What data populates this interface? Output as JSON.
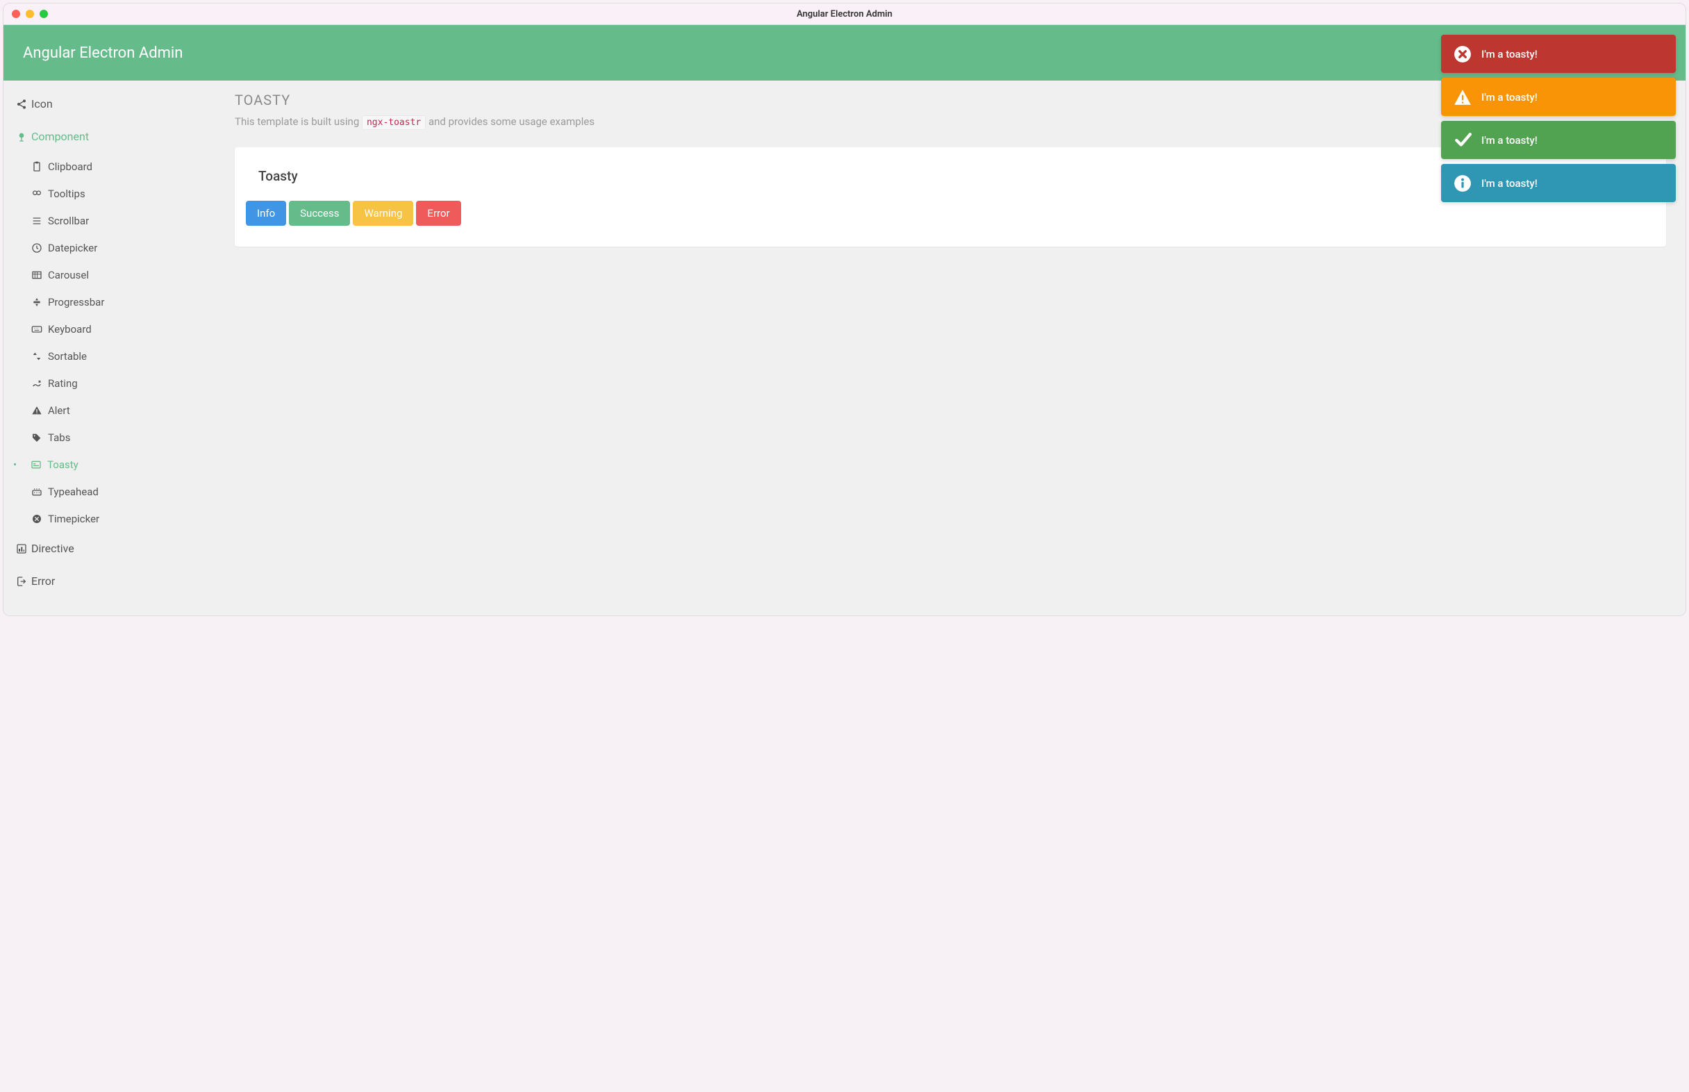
{
  "window_title": "Angular Electron Admin",
  "header_title": "Angular Electron Admin",
  "sidebar": {
    "icon_label": "Icon",
    "component_label": "Component",
    "directive_label": "Directive",
    "error_label": "Error",
    "components": [
      {
        "label": "Clipboard",
        "icon": "clipboard"
      },
      {
        "label": "Tooltips",
        "icon": "tooltips"
      },
      {
        "label": "Scrollbar",
        "icon": "scrollbar"
      },
      {
        "label": "Datepicker",
        "icon": "datepicker"
      },
      {
        "label": "Carousel",
        "icon": "carousel"
      },
      {
        "label": "Progressbar",
        "icon": "progressbar"
      },
      {
        "label": "Keyboard",
        "icon": "keyboard"
      },
      {
        "label": "Sortable",
        "icon": "sortable"
      },
      {
        "label": "Rating",
        "icon": "rating"
      },
      {
        "label": "Alert",
        "icon": "alert"
      },
      {
        "label": "Tabs",
        "icon": "tabs"
      },
      {
        "label": "Toasty",
        "icon": "toasty",
        "active": true
      },
      {
        "label": "Typeahead",
        "icon": "typeahead"
      },
      {
        "label": "Timepicker",
        "icon": "timepicker"
      }
    ]
  },
  "page": {
    "heading": "TOASTY",
    "desc_pre": "This template is built using ",
    "desc_code": "ngx-toastr",
    "desc_post": " and provides some usage examples",
    "card_title": "Toasty",
    "buttons": {
      "info": "Info",
      "success": "Success",
      "warning": "Warning",
      "error": "Error"
    }
  },
  "toasts": [
    {
      "type": "error",
      "message": "I'm a toasty!"
    },
    {
      "type": "warning",
      "message": "I'm a toasty!"
    },
    {
      "type": "success",
      "message": "I'm a toasty!"
    },
    {
      "type": "info",
      "message": "I'm a toasty!"
    }
  ],
  "colors": {
    "primary": "#66bb8a",
    "toast_error": "#bd362f",
    "toast_warning": "#f89406",
    "toast_success": "#51a351",
    "toast_info": "#2f96b4"
  }
}
